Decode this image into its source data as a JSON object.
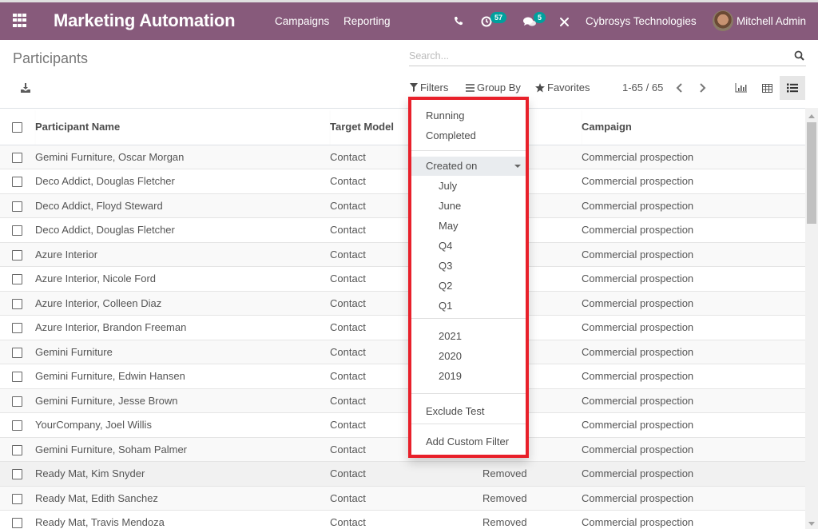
{
  "navbar": {
    "app_title": "Marketing Automation",
    "menu": [
      "Campaigns",
      "Reporting"
    ],
    "icons": {
      "apps": "apps-grid-icon",
      "phone": "phone-icon",
      "activity": "clock-activity-icon",
      "messages": "chat-icon",
      "debug": "tools-icon"
    },
    "activity_count": "57",
    "message_count": "5",
    "company": "Cybrosys Technologies",
    "user": "Mitchell Admin",
    "color": "#875a7b",
    "badge_color": "#00a09d"
  },
  "control_panel": {
    "breadcrumb": "Participants",
    "search_placeholder": "Search...",
    "download_icon": "download-icon",
    "filters_label": "Filters",
    "group_by_label": "Group By",
    "favorites_label": "Favorites",
    "pager": "1-65 / 65",
    "views": [
      "graph",
      "pivot",
      "list"
    ],
    "active_view": "list"
  },
  "filters_dropdown": {
    "highlight_color": "#e8202a",
    "items": {
      "running": "Running",
      "completed": "Completed",
      "created_on": "Created on",
      "months": [
        "July",
        "June",
        "May"
      ],
      "quarters": [
        "Q4",
        "Q3",
        "Q2",
        "Q1"
      ],
      "years": [
        "2021",
        "2020",
        "2019"
      ],
      "exclude_test": "Exclude Test",
      "add_custom": "Add Custom Filter"
    }
  },
  "table": {
    "columns": [
      "Participant Name",
      "Target Model",
      "",
      "Campaign"
    ],
    "rows": [
      {
        "name": "Gemini Furniture, Oscar Morgan",
        "model": "Contact",
        "state": "",
        "campaign": "Commercial prospection"
      },
      {
        "name": "Deco Addict, Douglas Fletcher",
        "model": "Contact",
        "state": "",
        "campaign": "Commercial prospection"
      },
      {
        "name": "Deco Addict, Floyd Steward",
        "model": "Contact",
        "state": "",
        "campaign": "Commercial prospection"
      },
      {
        "name": "Deco Addict, Douglas Fletcher",
        "model": "Contact",
        "state": "",
        "campaign": "Commercial prospection"
      },
      {
        "name": "Azure Interior",
        "model": "Contact",
        "state": "",
        "campaign": "Commercial prospection"
      },
      {
        "name": "Azure Interior, Nicole Ford",
        "model": "Contact",
        "state": "",
        "campaign": "Commercial prospection"
      },
      {
        "name": "Azure Interior, Colleen Diaz",
        "model": "Contact",
        "state": "",
        "campaign": "Commercial prospection"
      },
      {
        "name": "Azure Interior, Brandon Freeman",
        "model": "Contact",
        "state": "",
        "campaign": "Commercial prospection"
      },
      {
        "name": "Gemini Furniture",
        "model": "Contact",
        "state": "",
        "campaign": "Commercial prospection"
      },
      {
        "name": "Gemini Furniture, Edwin Hansen",
        "model": "Contact",
        "state": "",
        "campaign": "Commercial prospection"
      },
      {
        "name": "Gemini Furniture, Jesse Brown",
        "model": "Contact",
        "state": "",
        "campaign": "Commercial prospection"
      },
      {
        "name": "YourCompany, Joel Willis",
        "model": "Contact",
        "state": "",
        "campaign": "Commercial prospection"
      },
      {
        "name": "Gemini Furniture, Soham Palmer",
        "model": "Contact",
        "state": "",
        "campaign": "Commercial prospection"
      },
      {
        "name": "Ready Mat, Kim Snyder",
        "model": "Contact",
        "state": "Removed",
        "campaign": "Commercial prospection"
      },
      {
        "name": "Ready Mat, Edith Sanchez",
        "model": "Contact",
        "state": "Removed",
        "campaign": "Commercial prospection"
      },
      {
        "name": "Ready Mat, Travis Mendoza",
        "model": "Contact",
        "state": "Removed",
        "campaign": "Commercial prospection"
      }
    ]
  }
}
